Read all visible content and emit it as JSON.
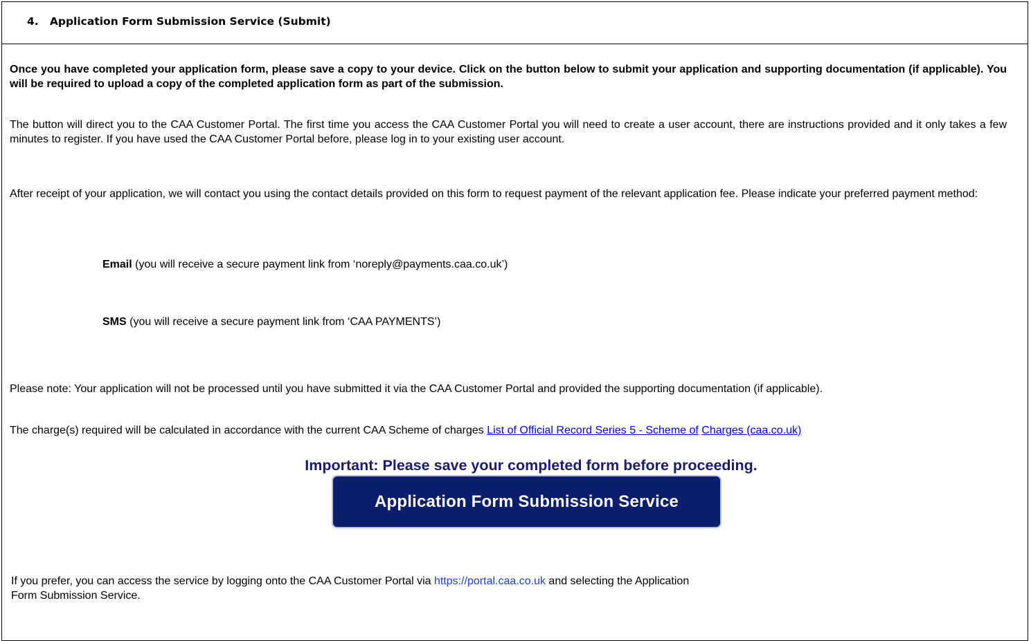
{
  "section": {
    "title": "4.   Application Form Submission Service (Submit)"
  },
  "intro_bold": "Once you have completed your application form, please save a copy to your device. Click on the button below to submit your application and supporting documentation (if applicable). You will be required to upload a copy of the completed application form as part of the submission.",
  "portal_info": "The button will direct you to the CAA Customer Portal. The first time you access the CAA Customer Portal you will need to create a user account, there are instructions provided and it only takes a few minutes to register.  If you have used the CAA Customer Portal before, please log in to your existing user account.",
  "payment_info": "After receipt of your application, we will contact you using the contact details provided on this form to request payment of the relevant application fee.  Please indicate your preferred payment method:",
  "payment_options": [
    {
      "label": "Email",
      "detail": " (you will receive a secure payment link from ‘noreply@payments.caa.co.uk’)"
    },
    {
      "label": "SMS",
      "detail": " (you will receive a secure payment link from ‘CAA PAYMENTS’)"
    }
  ],
  "note": "Please note: Your application will not be processed until you have submitted it via the CAA Customer Portal and provided the supporting documentation (if applicable).",
  "charges": {
    "text": "The charge(s) required will be calculated in accordance with the current CAA Scheme of charges ",
    "link1": "List of Official Record Series 5 - Scheme of",
    "link2": "Charges (caa.co.uk)"
  },
  "important": "Important: Please save your completed form before proceeding.",
  "submit_button": "Application Form Submission Service",
  "alt_access": {
    "before": "If you prefer, you can access the service by logging onto the CAA Customer Portal via ",
    "url": "https://portal.caa.co.uk",
    "after": " and selecting the Application",
    "line2": "Form Submission Service."
  }
}
